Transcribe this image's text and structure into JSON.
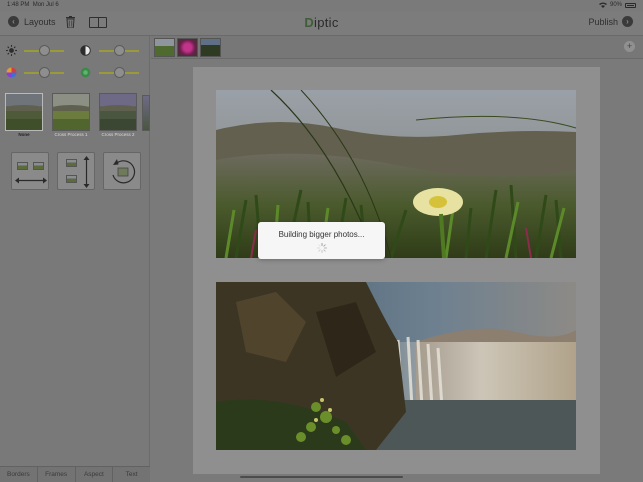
{
  "status": {
    "time": "1:48 PM",
    "date": "Mon Jul 6",
    "battery": "90%",
    "wifi_icon": "wifi-icon"
  },
  "toolbar": {
    "back_label": "Layouts",
    "app_title": "iptic",
    "publish_label": "Publish"
  },
  "filters": [
    {
      "label": "None",
      "selected": true
    },
    {
      "label": "Cross Process 1",
      "selected": false
    },
    {
      "label": "Cross Process 2",
      "selected": false
    }
  ],
  "tabs": [
    "Borders",
    "Frames",
    "Aspect",
    "Text"
  ],
  "toast": {
    "message": "Building bigger photos..."
  },
  "colors": {
    "accent_slider": "#9a9a3a",
    "panel": "#797979",
    "toast_bg": "#f6f6f6"
  }
}
